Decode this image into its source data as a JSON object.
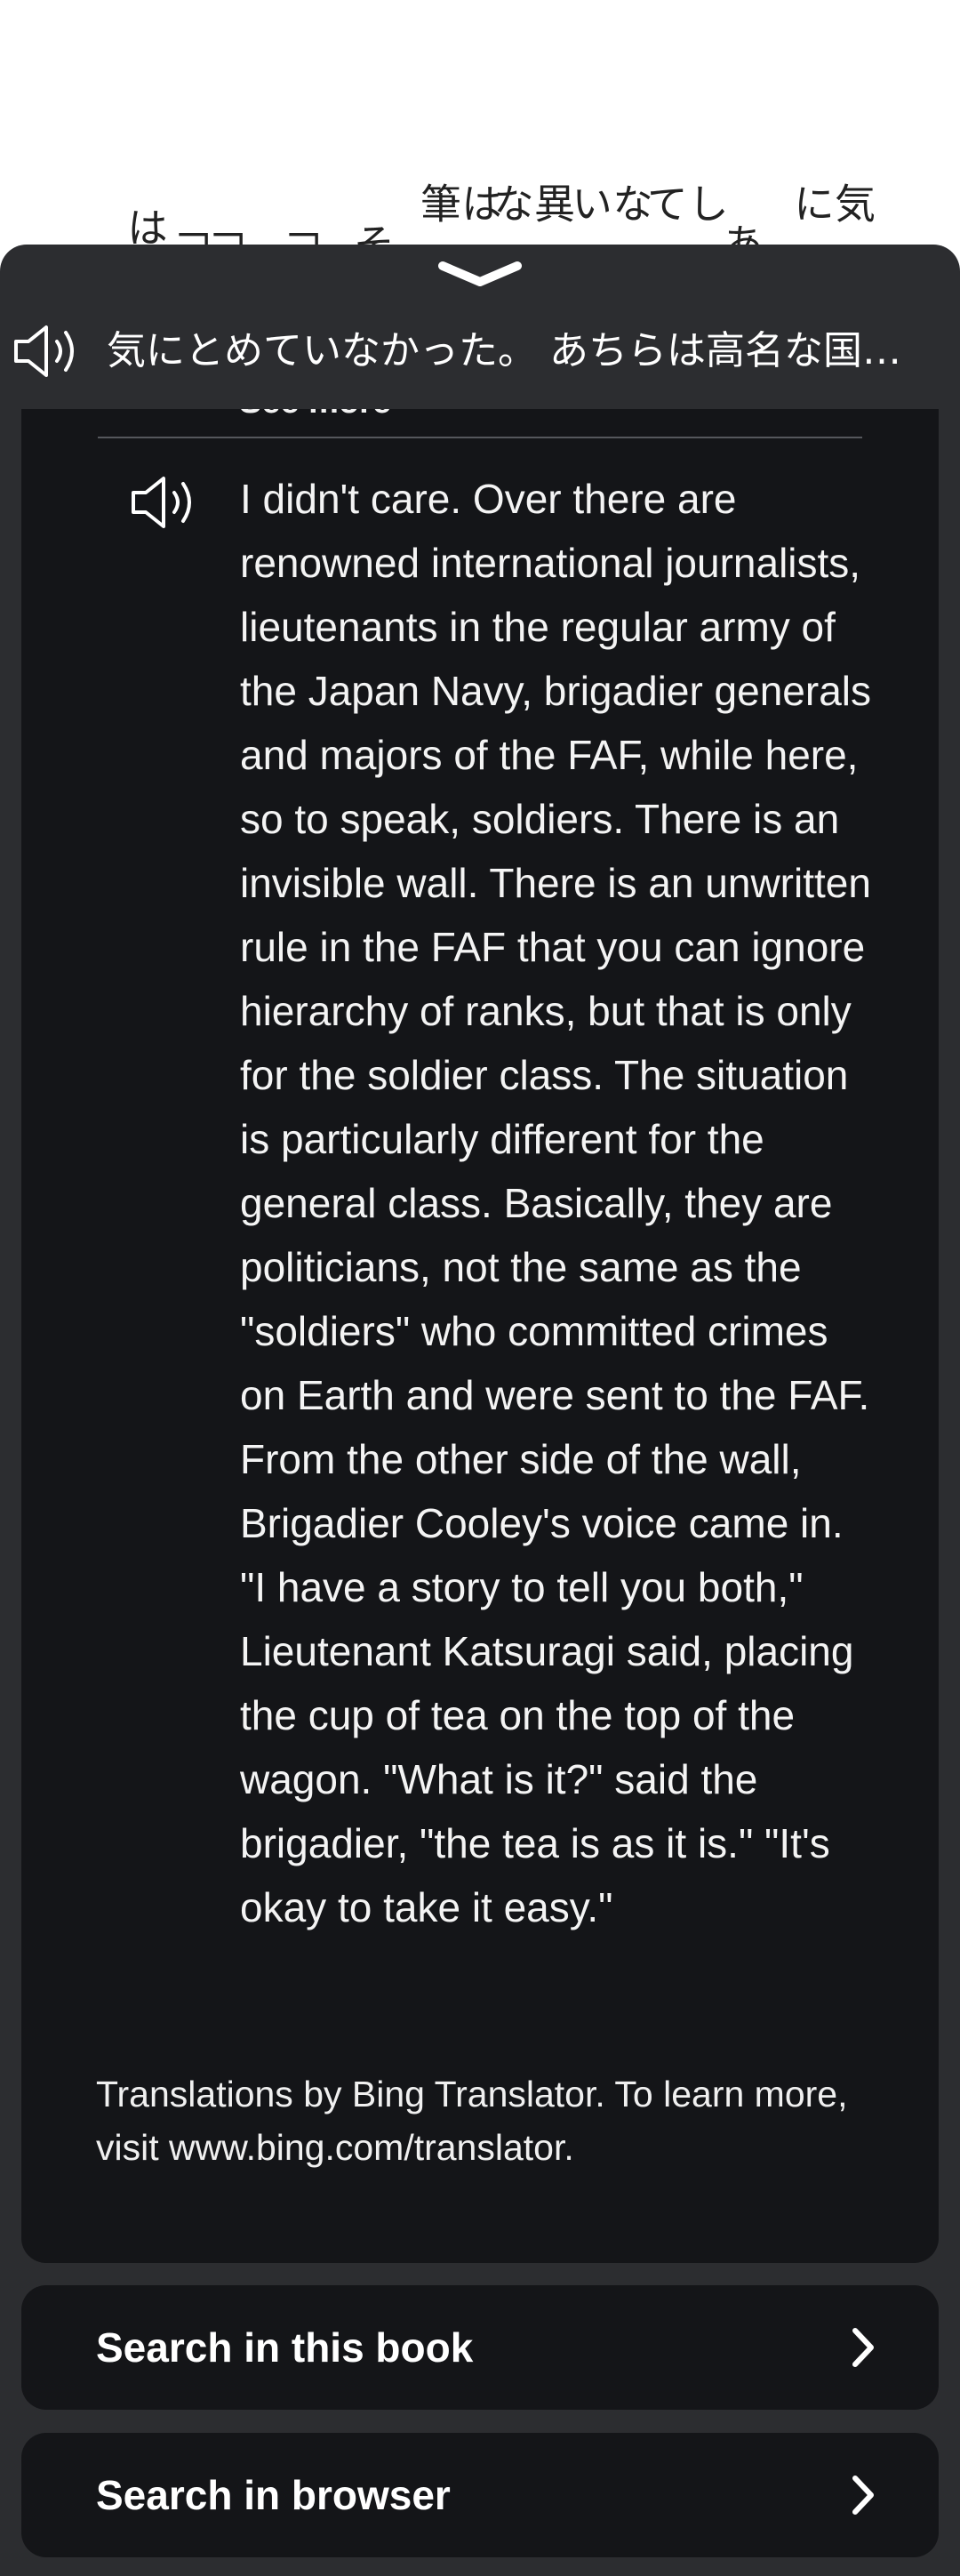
{
  "background_page": {
    "columns": [
      {
        "text": "「おは"
      },
      {
        "text": "「く"
      },
      {
        "text": "「三"
      },
      {
        "text": "そ"
      },
      {
        "text": "は筆"
      },
      {
        "text": "異な"
      },
      {
        "text": "ない"
      },
      {
        "text": "して"
      },
      {
        "text": "あ"
      },
      {
        "text": "気に"
      }
    ]
  },
  "header": {
    "speaker_icon": "speaker-icon",
    "source_text": "気にとめていなかった。 あちらは高名な国際ジャーナリスト"
  },
  "translation": {
    "see_more_label": "See more",
    "speaker_icon": "speaker-icon",
    "text": "I didn't care. Over there are renowned international journalists, lieutenants in the regular army of the Japan Navy, brigadier generals and majors of the FAF, while here, so to speak, soldiers. There is an invisible wall. There is an unwritten rule in the FAF that you can ignore hierarchy of ranks, but that is only for the soldier class. The situation is particularly different for the general class. Basically, they are politicians, not the same as the \"soldiers\" who committed crimes on Earth and were sent to the FAF. From the other side of the wall, Brigadier Cooley's voice came in. \"I have a story to tell you both,\" Lieutenant Katsuragi said, placing the cup of tea on the top of the wagon. \"What is it?\" said the brigadier, \"the tea is as it is.\" \"It's okay to take it easy.\"",
    "attribution": "Translations by Bing Translator. To learn more, visit www.bing.com/translator."
  },
  "actions": {
    "search_book_label": "Search in this book",
    "search_browser_label": "Search in browser",
    "chevron_icon": "chevron-right-icon"
  },
  "colors": {
    "sheet_bg": "#2c2d30",
    "card_bg": "#141518",
    "text": "#f4f4f4"
  }
}
